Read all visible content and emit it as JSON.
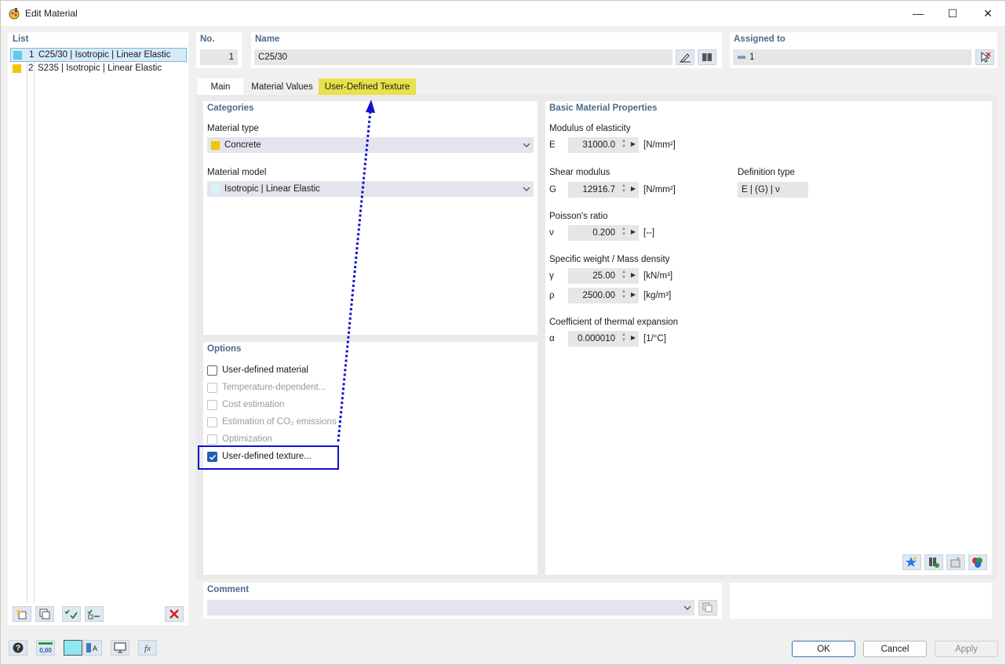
{
  "window": {
    "title": "Edit Material",
    "minimize": "—",
    "maximize": "☐",
    "close": "✕"
  },
  "list": {
    "title": "List",
    "items": [
      {
        "no": "1",
        "label": "C25/30 | Isotropic | Linear Elastic",
        "color": "#5fc8e8",
        "selected": true
      },
      {
        "no": "2",
        "label": "S235 | Isotropic | Linear Elastic",
        "color": "#f5c400",
        "selected": false
      }
    ]
  },
  "header": {
    "no_label": "No.",
    "no_value": "1",
    "name_label": "Name",
    "name_value": "C25/30",
    "assigned_label": "Assigned to",
    "assigned_value": "1"
  },
  "tabs": [
    {
      "label": "Main",
      "active": true
    },
    {
      "label": "Material Values",
      "active": false
    },
    {
      "label": "User-Defined Texture",
      "active": false,
      "highlight": "#e8e24a"
    }
  ],
  "categories": {
    "title": "Categories",
    "material_type_label": "Material type",
    "material_type_value": "Concrete",
    "material_type_color": "#f5c400",
    "material_model_label": "Material model",
    "material_model_value": "Isotropic | Linear Elastic",
    "material_model_color": "#d8f4fb"
  },
  "options": {
    "title": "Options",
    "items": [
      {
        "label": "User-defined material",
        "checked": false,
        "enabled": true
      },
      {
        "label": "Temperature-dependent...",
        "checked": false,
        "enabled": false
      },
      {
        "label": "Cost estimation",
        "checked": false,
        "enabled": false
      },
      {
        "label": "Estimation of CO₂ emissions",
        "checked": false,
        "enabled": false
      },
      {
        "label": "Optimization",
        "checked": false,
        "enabled": false
      },
      {
        "label": "User-defined texture...",
        "checked": true,
        "enabled": true
      }
    ]
  },
  "properties": {
    "title": "Basic Material Properties",
    "modulus_title": "Modulus of elasticity",
    "E_symbol": "E",
    "E_value": "31000.0",
    "E_unit": "[N/mm²]",
    "shear_title": "Shear modulus",
    "G_symbol": "G",
    "G_value": "12916.7",
    "G_unit": "[N/mm²]",
    "definition_type_label": "Definition type",
    "definition_type_value": "E | (G) | ν",
    "poisson_title": "Poisson's ratio",
    "nu_symbol": "ν",
    "nu_value": "0.200",
    "nu_unit": "[--]",
    "weight_title": "Specific weight / Mass density",
    "gamma_symbol": "γ",
    "gamma_value": "25.00",
    "gamma_unit": "[kN/m³]",
    "rho_symbol": "ρ",
    "rho_value": "2500.00",
    "rho_unit": "[kg/m³]",
    "thermal_title": "Coefficient of thermal expansion",
    "alpha_symbol": "α",
    "alpha_value": "0.000010",
    "alpha_unit": "[1/°C]"
  },
  "comment": {
    "title": "Comment",
    "value": ""
  },
  "footer": {
    "ok": "OK",
    "cancel": "Cancel",
    "apply": "Apply"
  },
  "colors": {
    "section_title": "#4a6a8a",
    "annotation": "#1010d0",
    "check_blue": "#1f5fb0"
  }
}
